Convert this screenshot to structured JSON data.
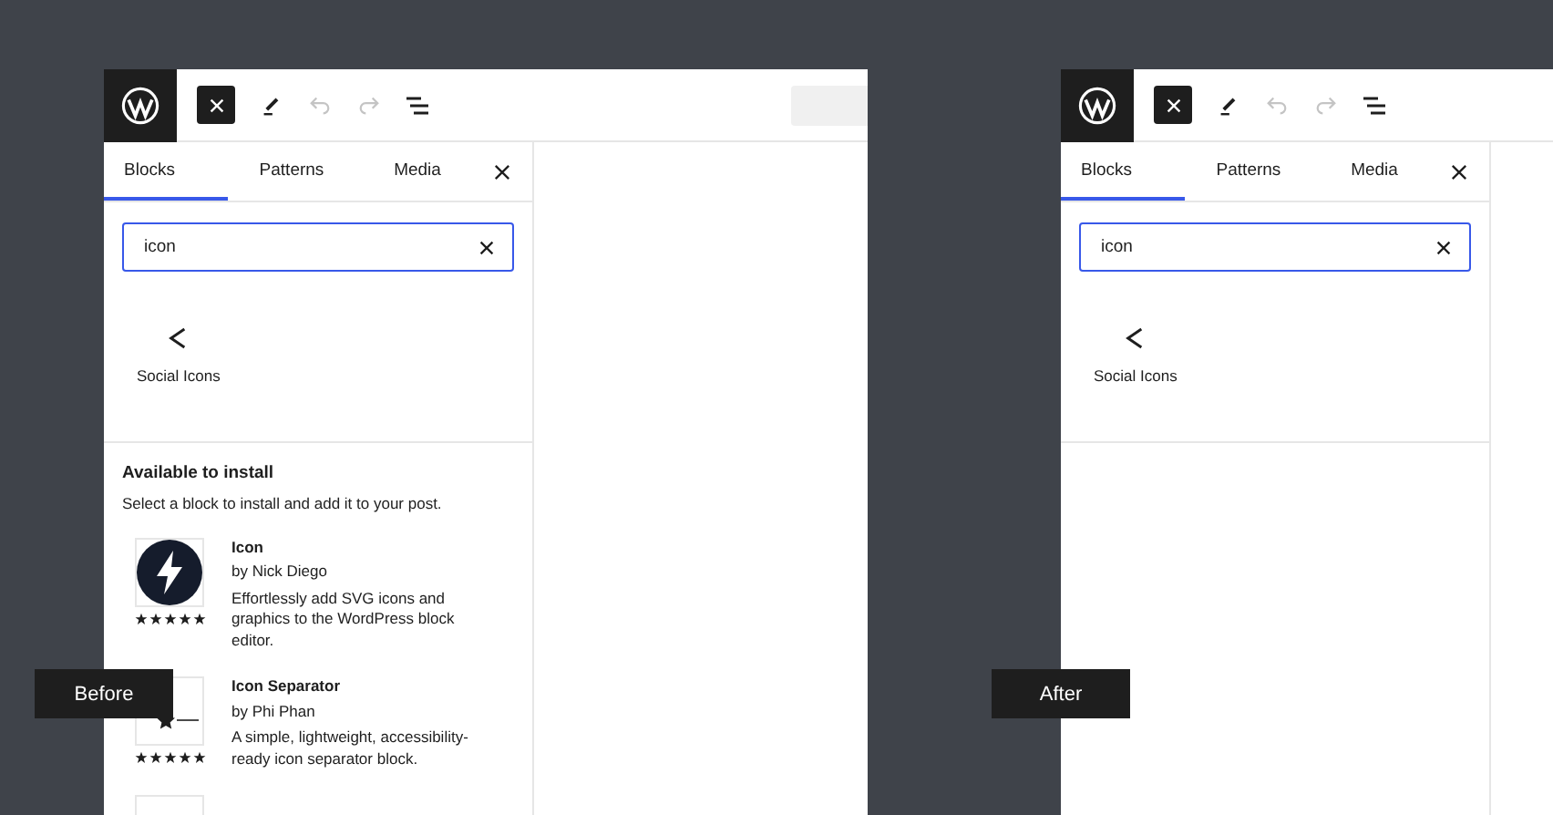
{
  "panels": [
    {
      "caption": "Before",
      "toolbar": [
        {
          "kind": "close",
          "disabled": false
        },
        {
          "kind": "pen",
          "disabled": false
        },
        {
          "kind": "undo",
          "disabled": true
        },
        {
          "kind": "redo",
          "disabled": true
        },
        {
          "kind": "list",
          "disabled": false
        }
      ],
      "tabs": [
        {
          "label": "Blocks",
          "selected": true
        },
        {
          "label": "Patterns",
          "selected": false
        },
        {
          "label": "Media",
          "selected": false
        }
      ],
      "search": {
        "value": "icon"
      },
      "results": [
        {
          "name": "Social Icons"
        }
      ],
      "install": {
        "title": "Available to install",
        "hint": "Select a block to install and add it to your post.",
        "items": [
          {
            "kind": "bolt",
            "name": "Icon",
            "author": "by Nick Diego",
            "description": "Effortlessly add SVG icons and graphics to the WordPress block editor.",
            "stars": 5
          },
          {
            "kind": "separator",
            "name": "Icon Separator",
            "author": "by Phi Phan",
            "description": "A simple, lightweight, accessibility-ready icon separator block.",
            "stars": 5
          },
          {
            "kind": "blank"
          }
        ]
      }
    },
    {
      "caption": "After",
      "toolbar": [
        {
          "kind": "close",
          "disabled": false
        },
        {
          "kind": "pen",
          "disabled": false
        },
        {
          "kind": "undo",
          "disabled": true
        },
        {
          "kind": "redo",
          "disabled": true
        },
        {
          "kind": "list",
          "disabled": false
        }
      ],
      "tabs": [
        {
          "label": "Blocks",
          "selected": true
        },
        {
          "label": "Patterns",
          "selected": false
        },
        {
          "label": "Media",
          "selected": false
        }
      ],
      "search": {
        "value": "icon"
      },
      "results": [
        {
          "name": "Social Icons"
        }
      ]
    }
  ]
}
